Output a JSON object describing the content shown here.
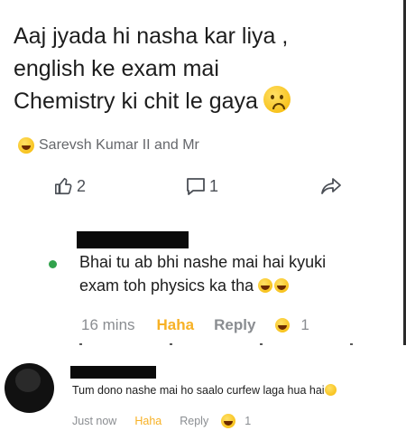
{
  "post": {
    "lines": [
      "Aaj jyada hi nasha kar liya ,",
      "english ke exam mai",
      "Chemistry ki chit le gaya"
    ],
    "reactors": "Sarevsh Kumar II and Mr",
    "like_count": "2",
    "comment_count": "1"
  },
  "comment1": {
    "text_line1": "Bhai tu ab bhi nashe mai hai kyuki",
    "text_line2": "exam toh physics ka tha",
    "time": "16 mins",
    "haha_label": "Haha",
    "reply_label": "Reply",
    "reaction_count": "1"
  },
  "comment2": {
    "text": "Tum dono nashe mai ho saalo curfew laga hua hai",
    "time": "Just now",
    "haha_label": "Haha",
    "reply_label": "Reply",
    "reaction_count": "1"
  },
  "colors": {
    "haha": "#f7b125",
    "online": "#31a24c",
    "meta": "#8a8d91"
  }
}
